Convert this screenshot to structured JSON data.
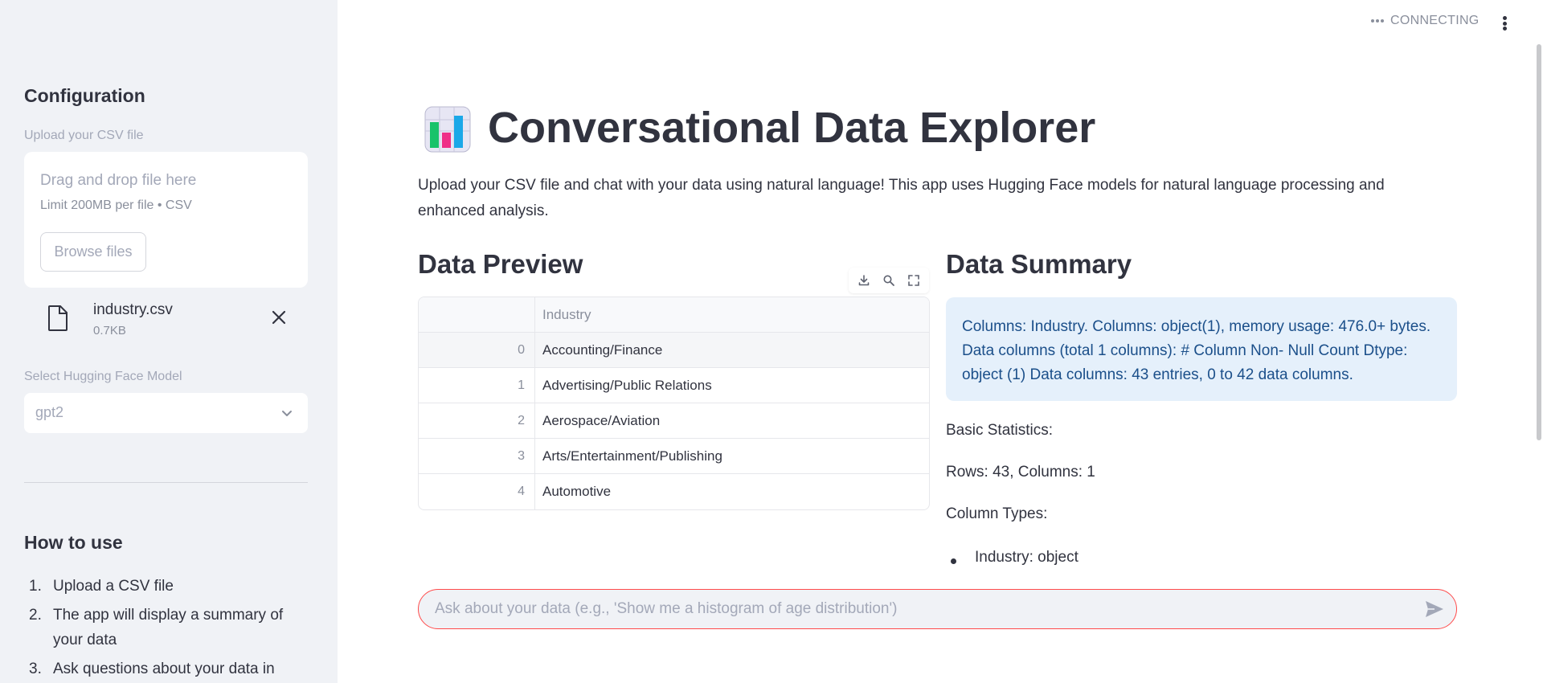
{
  "sidebar": {
    "config_heading": "Configuration",
    "upload_label": "Upload your CSV file",
    "dropzone_title": "Drag and drop file here",
    "dropzone_limit": "Limit 200MB per file • CSV",
    "browse_label": "Browse files",
    "file": {
      "name": "industry.csv",
      "size": "0.7KB"
    },
    "model_label": "Select Hugging Face Model",
    "model_value": "gpt2",
    "howto_heading": "How to use",
    "howto_steps": [
      {
        "num": "1.",
        "text": "Upload a CSV file"
      },
      {
        "num": "2.",
        "text": "The app will display a summary of your data"
      },
      {
        "num": "3.",
        "text": "Ask questions about your data in"
      }
    ]
  },
  "header": {
    "status": "CONNECTING"
  },
  "main": {
    "title": "Conversational Data Explorer",
    "intro": "Upload your CSV file and chat with your data using natural language! This app uses Hugging Face models for natural language processing and enhanced analysis.",
    "preview_heading": "Data Preview",
    "summary_heading": "Data Summary"
  },
  "table": {
    "column_header": "Industry",
    "rows": [
      {
        "idx": "0",
        "value": "Accounting/Finance"
      },
      {
        "idx": "1",
        "value": "Advertising/Public Relations"
      },
      {
        "idx": "2",
        "value": "Aerospace/Aviation"
      },
      {
        "idx": "3",
        "value": "Arts/Entertainment/Publishing"
      },
      {
        "idx": "4",
        "value": "Automotive"
      }
    ]
  },
  "summary": {
    "info_text": "Columns: Industry. Columns: object(1), memory usage: 476.0+ bytes. Data columns (total 1 columns): # Column Non- Null Count Dtype: object (1) Data columns: 43 entries, 0 to 42 data columns.",
    "basic_stats_label": "Basic Statistics:",
    "rows_cols": "Rows: 43, Columns: 1",
    "column_types_label": "Column Types:",
    "column_types": [
      "Industry: object"
    ]
  },
  "chat": {
    "placeholder": "Ask about your data (e.g., 'Show me a histogram of age distribution')"
  },
  "colors": {
    "sidebar_bg": "#f0f2f6",
    "info_bg": "#e5f0fb",
    "info_text": "#1b4f8a",
    "chat_border": "#ff4b4b",
    "text": "#31333f"
  },
  "icons": [
    "file-icon",
    "close-icon",
    "chevron-down-icon",
    "more-dots-icon",
    "kebab-menu-icon",
    "download-icon",
    "search-icon",
    "fullscreen-icon",
    "bar-chart-icon",
    "send-icon"
  ]
}
